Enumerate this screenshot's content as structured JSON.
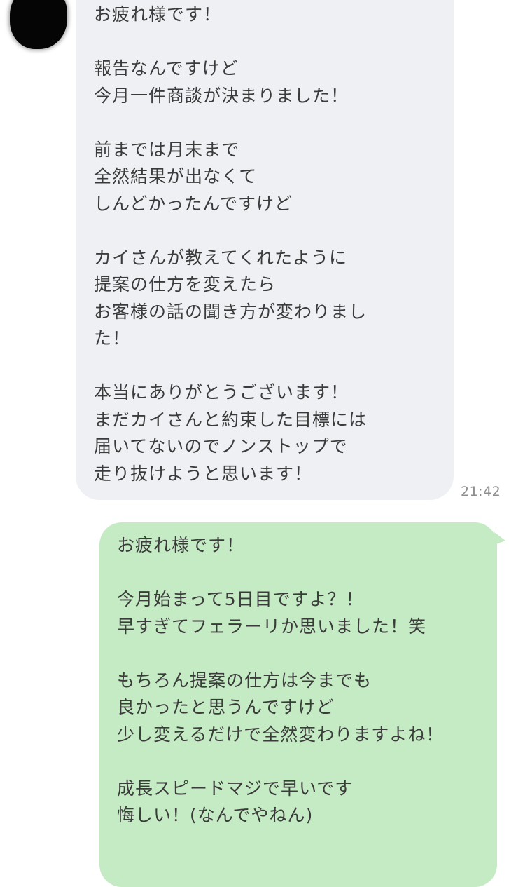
{
  "incoming_message": {
    "lines": [
      "お疲れ様です！",
      "",
      "報告なんですけど",
      "今月一件商談が決まりました！",
      "",
      "前までは月末まで",
      "全然結果が出なくて",
      "しんどかったんですけど",
      "",
      "カイさんが教えてくれたように",
      "提案の仕方を変えたら",
      "お客様の話の聞き方が変わりまし",
      "た！",
      "",
      "本当にありがとうございます！",
      "まだカイさんと約束した目標には",
      "届いてないのでノンストップで",
      "走り抜けようと思います！"
    ],
    "time": "21:42"
  },
  "outgoing_message": {
    "lines": [
      "お疲れ様です！",
      "",
      "今月始まって5日目ですよ？！",
      "早すぎてフェラーリか思いました！笑",
      "",
      "もちろん提案の仕方は今までも",
      "良かったと思うんですけど",
      "少し変えるだけで全然変わりますよね！",
      "",
      "成長スピードマジで早いです",
      "悔しい！(なんでやねん)"
    ]
  },
  "colors": {
    "incoming_bubble": "#eef0f3",
    "outgoing_bubble": "#c4ebc3",
    "text": "#3b3b3b",
    "timestamp": "#8c8c8c"
  },
  "icons": {
    "avatar": "avatar-icon"
  }
}
